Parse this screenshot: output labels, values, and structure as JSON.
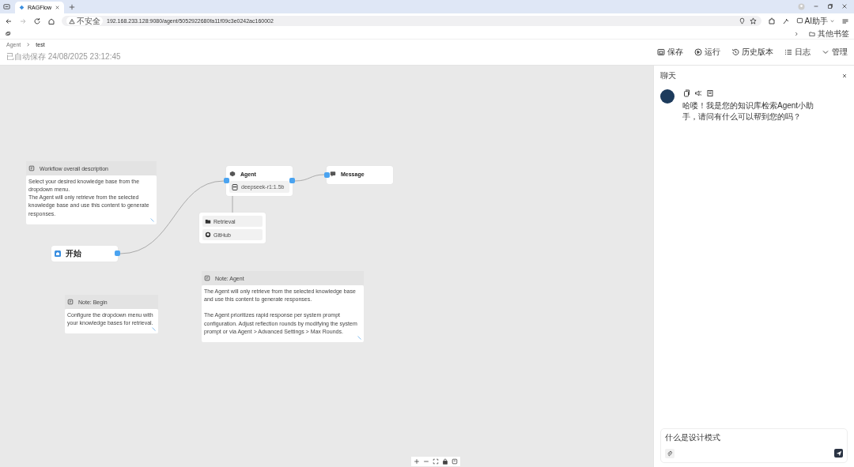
{
  "browser": {
    "tabs": [
      {
        "label": "RAGFlow",
        "selected": true
      }
    ],
    "security_label": "不安全",
    "url": "192.168.233.128:9080/agent/5052922680fa11f09c3e0242ac160002",
    "ai_button": "AI助手",
    "bookmarks_folder": "其他书签"
  },
  "header": {
    "breadcrumb": [
      "Agent",
      "test"
    ],
    "autosave": "已自动保存 24/08/2025 23:12:45",
    "actions": [
      {
        "kind": "save",
        "label": "保存"
      },
      {
        "kind": "run",
        "label": "运行"
      },
      {
        "kind": "history",
        "label": "历史版本"
      },
      {
        "kind": "log",
        "label": "日志"
      },
      {
        "kind": "manage",
        "label": "管理"
      }
    ]
  },
  "canvas": {
    "notes": [
      {
        "title": "Workflow overall description",
        "text": "Select your desired knowledge base from the dropdown menu.\nThe Agent will only retrieve from the selected knowledge base and use this content  to generate responses."
      },
      {
        "title": "Note: Agent",
        "text": "The Agent will only retrieve from the selected knowledge base and use this content  to generate responses.\n\nThe Agent prioritizes rapid response per system prompt configuration. Adjust reflection rounds by modifying the system prompt or via Agent > Advanced Settings > Max Rounds."
      },
      {
        "title": "Note: Begin",
        "text": "Configure the dropdown menu with your knowledge bases for retrieval."
      }
    ],
    "nodes": [
      {
        "kind": "begin",
        "title": "开始"
      },
      {
        "kind": "agent",
        "title": "Agent",
        "model": "deepseek-r1:1.5b"
      },
      {
        "kind": "message",
        "title": "Message"
      },
      {
        "kind": "tools",
        "tools": [
          "Retrieval",
          "GitHub"
        ]
      }
    ]
  },
  "chat": {
    "title": "聊天",
    "messages": [
      {
        "text": "哈喽！我是您的知识库检索Agent小助手，请问有什么可以帮到您的吗？"
      }
    ],
    "input": {
      "value": "什么是设计模式"
    }
  }
}
